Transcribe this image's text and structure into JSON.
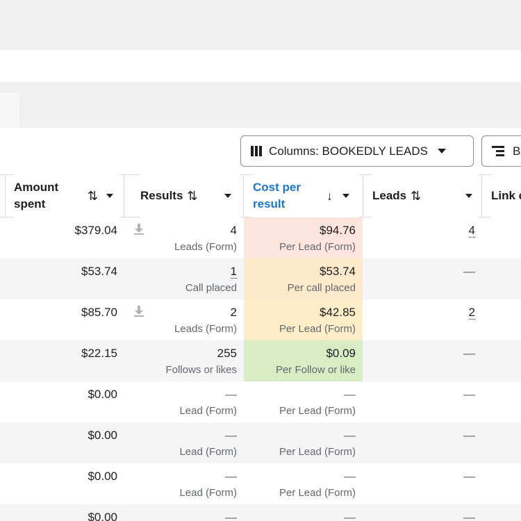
{
  "toolbar": {
    "columns_label": "Columns: BOOKEDLY LEADS",
    "breakdown_label": "B"
  },
  "columns": {
    "amount_spent": "Amount spent",
    "results": "Results",
    "cost_per_result": "Cost per result",
    "leads": "Leads",
    "link": "Link c"
  },
  "sort_icons": {
    "both": "⇅",
    "down": "↓"
  },
  "rows": [
    {
      "amount": "$379.04",
      "results": "4",
      "results_sub": "Leads (Form)",
      "cost": "$94.76",
      "cost_sub": "Per Lead (Form)",
      "leads": "4",
      "cost_color": "#fde4dd",
      "download": true
    },
    {
      "amount": "$53.74",
      "results": "1",
      "results_sub": "Call placed",
      "cost": "$53.74",
      "cost_sub": "Per call placed",
      "leads": "—",
      "cost_color": "#fdeacb",
      "download": false
    },
    {
      "amount": "$85.70",
      "results": "2",
      "results_sub": "Leads (Form)",
      "cost": "$42.85",
      "cost_sub": "Per Lead (Form)",
      "leads": "2",
      "cost_color": "#fdeec8",
      "download": true
    },
    {
      "amount": "$22.15",
      "results": "255",
      "results_sub": "Follows or likes",
      "cost": "$0.09",
      "cost_sub": "Per Follow or like",
      "leads": "—",
      "cost_color": "#d8edc4",
      "download": false
    },
    {
      "amount": "$0.00",
      "results": "—",
      "results_sub": "Lead (Form)",
      "cost": "—",
      "cost_sub": "Per Lead (Form)",
      "leads": "—",
      "cost_color": "",
      "download": false
    },
    {
      "amount": "$0.00",
      "results": "—",
      "results_sub": "Lead (Form)",
      "cost": "—",
      "cost_sub": "Per Lead (Form)",
      "leads": "—",
      "cost_color": "",
      "download": false
    },
    {
      "amount": "$0.00",
      "results": "—",
      "results_sub": "Lead (Form)",
      "cost": "—",
      "cost_sub": "Per Lead (Form)",
      "leads": "—",
      "cost_color": "",
      "download": false
    },
    {
      "amount": "$0.00",
      "results": "—",
      "results_sub": "",
      "cost": "—",
      "cost_sub": "",
      "leads": "—",
      "cost_color": "",
      "download": false
    }
  ]
}
